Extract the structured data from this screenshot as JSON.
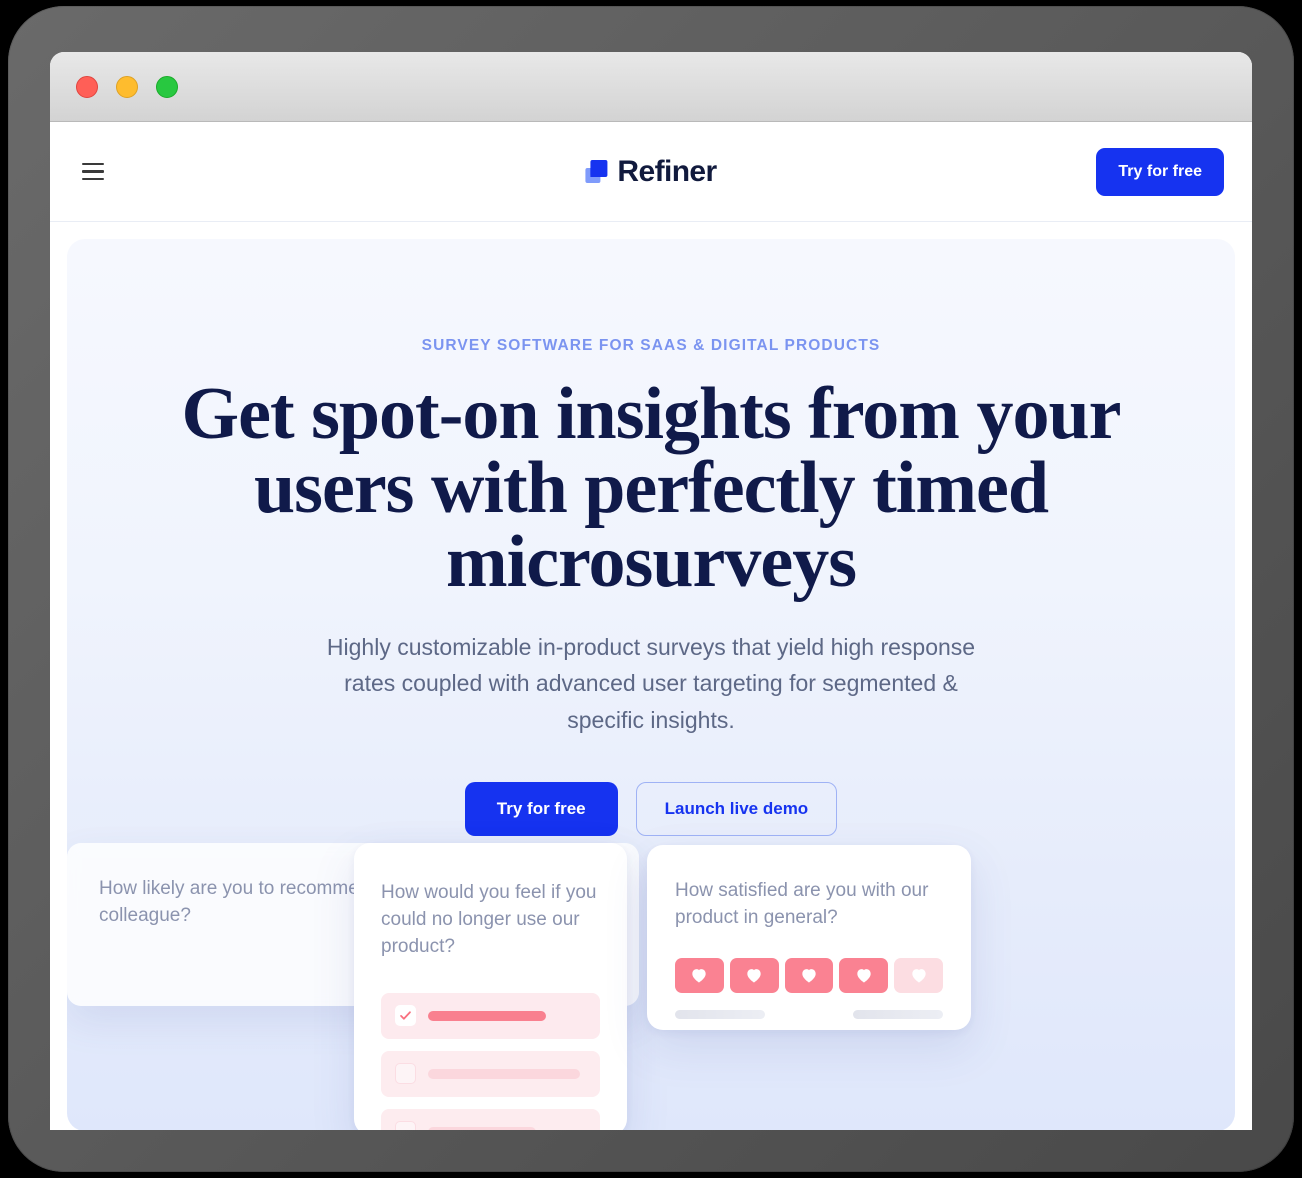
{
  "window": {
    "traffic_lights": [
      "close",
      "minimize",
      "maximize"
    ]
  },
  "header": {
    "menu_icon": "hamburger-menu-icon",
    "brand": "Refiner",
    "cta_label": "Try for free",
    "logo_colors": {
      "dark": "#1633f0",
      "light": "#7f9bfb"
    }
  },
  "hero": {
    "eyebrow": "SURVEY SOFTWARE FOR SAAS & DIGITAL PRODUCTS",
    "headline": "Get spot-on insights from your users with perfectly timed microsurveys",
    "subheadline": "Highly customizable in-product surveys that yield high response rates coupled with advanced user targeting for segmented & specific insights.",
    "cta_primary": "Try for free",
    "cta_secondary": "Launch live demo",
    "accent_color": "#1633f0",
    "eyebrow_color": "#7b94f0",
    "headline_color": "#101a4a"
  },
  "survey_cards": {
    "feel": {
      "question": "How would you feel if you could no longer use our product?",
      "options": [
        {
          "state": "selected",
          "bar": "strong"
        },
        {
          "state": "unselected",
          "bar": "faint1"
        },
        {
          "state": "unselected",
          "bar": "faint2"
        }
      ]
    },
    "satisfied": {
      "question": "How satisfied are you with our product in general?",
      "icon": "heart-icon",
      "scale_total": 5,
      "scale_filled": 4,
      "filled_color": "#fa8292",
      "empty_color": "#fcdde2"
    },
    "nps": {
      "question": "How likely are you to recommend our service to a friend or colleague?"
    }
  }
}
